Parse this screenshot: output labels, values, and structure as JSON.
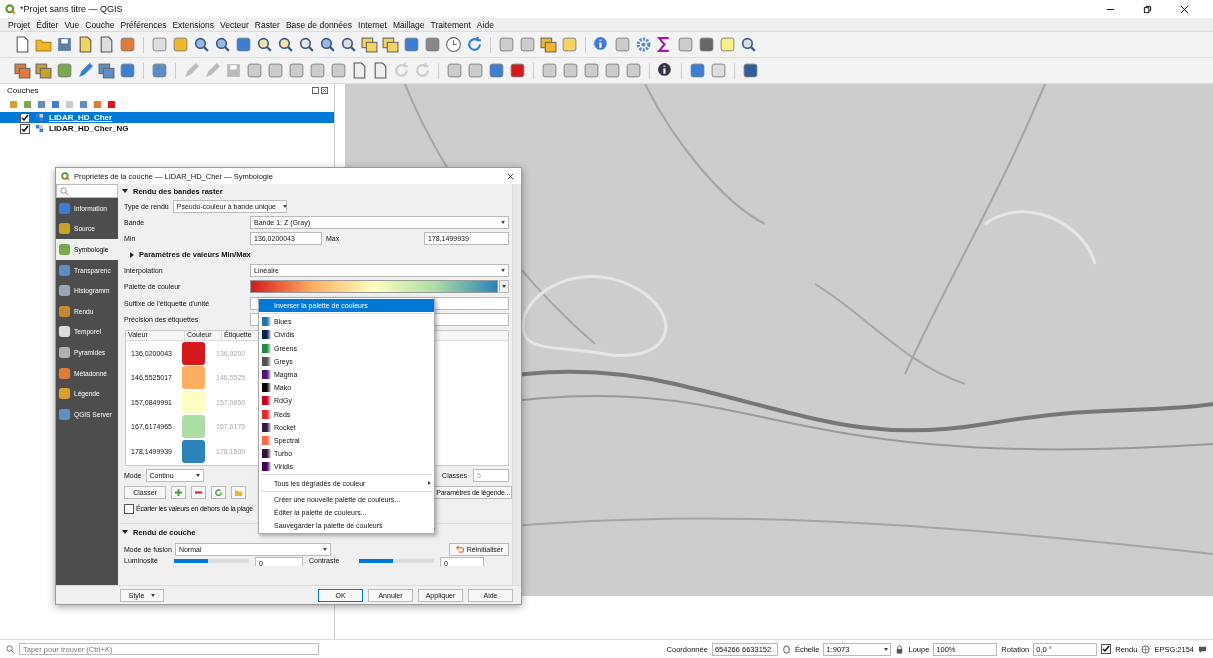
{
  "window": {
    "title": "*Projet sans titre — QGIS"
  },
  "menu": [
    "Projet",
    "Éditer",
    "Vue",
    "Couche",
    "Préférences",
    "Extensions",
    "Vecteur",
    "Raster",
    "Base de données",
    "Internet",
    "Maillage",
    "Traitement",
    "Aide"
  ],
  "layers_panel": {
    "title": "Couches",
    "layers": [
      {
        "name": "LIDAR_HD_Cher",
        "checked": true,
        "selected": true
      },
      {
        "name": "LIDAR_HD_Cher_NG",
        "checked": true,
        "selected": false
      }
    ]
  },
  "dialog": {
    "title": "Propriétés de la couche — LIDAR_HD_Cher — Symbologie",
    "sidebar": [
      {
        "label": "Information",
        "selected": false,
        "color": "#3a7fd5"
      },
      {
        "label": "Source",
        "selected": false,
        "color": "#c9a227"
      },
      {
        "label": "Symbologie",
        "selected": true,
        "color": "#7aa84a"
      },
      {
        "label": "Transparenc",
        "selected": false,
        "color": "#5b8ec9"
      },
      {
        "label": "Histogramm",
        "selected": false,
        "color": "#9aa7b5"
      },
      {
        "label": "Rendu",
        "selected": false,
        "color": "#c58a2e"
      },
      {
        "label": "Temporel",
        "selected": false,
        "color": "#dddddd"
      },
      {
        "label": "Pyramides",
        "selected": false,
        "color": "#b0b0b0"
      },
      {
        "label": "Métadonné",
        "selected": false,
        "color": "#e07b39"
      },
      {
        "label": "Légende",
        "selected": false,
        "color": "#d9a02b"
      },
      {
        "label": "QGIS Server",
        "selected": false,
        "color": "#5e8fc7"
      }
    ],
    "band_section": {
      "title": "Rendu des bandes raster",
      "expanded": true
    },
    "render_type": {
      "label": "Type de rendu",
      "value": "Pseudo-couleur à bande unique"
    },
    "band": {
      "label": "Bande",
      "value": "Bande 1: Z (Gray)"
    },
    "min": {
      "label": "Min",
      "value": "136,0200043"
    },
    "max": {
      "label": "Max",
      "value": "178,1499939"
    },
    "minmax_section": {
      "title": "Paramètres de valeurs Min/Max",
      "expanded": false
    },
    "interpolation": {
      "label": "Interpolation",
      "value": "Linéaire"
    },
    "palette": {
      "label": "Palette de couleur"
    },
    "unit_suffix": {
      "label": "Suffixe de l'étiquette d'unité"
    },
    "precision": {
      "label": "Précision des étiquettes"
    },
    "table": {
      "columns": [
        "Valeur",
        "Couleur",
        "Étiquette"
      ],
      "rows": [
        {
          "value": "136,0200043",
          "color": "#d7191c",
          "label": "136,0200"
        },
        {
          "value": "146,5525017",
          "color": "#fdae61",
          "label": "146,5525"
        },
        {
          "value": "157,0849991",
          "color": "#ffffbf",
          "label": "157,0850"
        },
        {
          "value": "167,6174965",
          "color": "#abdda4",
          "label": "167,6175"
        },
        {
          "value": "178,1499939",
          "color": "#2b83ba",
          "label": "178,1500"
        }
      ]
    },
    "mode": {
      "label": "Mode",
      "value": "Continu"
    },
    "classes": {
      "label": "Classes",
      "value": "5"
    },
    "classify_button": "Classer",
    "legend_button": "Paramètres de légende...",
    "clip_out_of_range": {
      "label": "Écarter les valeurs en dehors de la plage",
      "checked": false
    },
    "layer_section": {
      "title": "Rendu de couche",
      "expanded": true
    },
    "blend_mode": {
      "label": "Mode de fusion",
      "value": "Normal"
    },
    "reset_button": "Réinitialiser",
    "brightness": {
      "label": "Luminosité",
      "level": 0.45,
      "value": "0"
    },
    "contrast": {
      "label": "Contraste",
      "level": 0.45,
      "value": "0"
    },
    "style_button": "Style",
    "buttons": [
      "OK",
      "Annuler",
      "Appliquer",
      "Aide"
    ]
  },
  "ramp_menu": [
    {
      "kind": "action",
      "label": "Inverser la palette de couleurs",
      "selected": true
    },
    {
      "kind": "ramp",
      "label": "Blues",
      "color": "#2171b5",
      "selected": false
    },
    {
      "kind": "ramp",
      "label": "Cividis",
      "color": "#00224e",
      "selected": false
    },
    {
      "kind": "ramp",
      "label": "Greens",
      "color": "#238b45",
      "selected": false
    },
    {
      "kind": "ramp",
      "label": "Greys",
      "color": "#525252",
      "selected": false
    },
    {
      "kind": "ramp",
      "label": "Magma",
      "color": "#51127c",
      "selected": false
    },
    {
      "kind": "ramp",
      "label": "Mako",
      "color": "#0b0405",
      "selected": false
    },
    {
      "kind": "ramp",
      "label": "RdGy",
      "color": "#ca0020",
      "selected": false
    },
    {
      "kind": "ramp",
      "label": "Reds",
      "color": "#de2d26",
      "selected": false
    },
    {
      "kind": "ramp",
      "label": "Rocket",
      "color": "#35193e",
      "selected": false
    },
    {
      "kind": "ramp",
      "label": "Spectral",
      "color": "#f46d43",
      "selected": false
    },
    {
      "kind": "ramp",
      "label": "Turbo",
      "color": "#30123b",
      "selected": false
    },
    {
      "kind": "ramp",
      "label": "Viridis",
      "color": "#440154",
      "selected": false
    },
    {
      "kind": "submenu",
      "label": "Tous les dégradés de couleur",
      "selected": false
    },
    {
      "kind": "action",
      "label": "Créer une nouvelle palette de couleurs...",
      "selected": false
    },
    {
      "kind": "action",
      "label": "Éditer la palette de couleurs...",
      "selected": false
    },
    {
      "kind": "action",
      "label": "Sauvegarder la palette de couleurs",
      "selected": false
    }
  ],
  "status_bar": {
    "search_placeholder": "Taper pour trouver (Ctrl+K)",
    "coordinate": {
      "label": "Coordonnée",
      "value": "654266 6633152"
    },
    "scale": {
      "label": "Échelle",
      "value": "1:9073"
    },
    "magnifier": {
      "label": "Loupe",
      "value": "100%"
    },
    "rotation": {
      "label": "Rotation",
      "value": "0,0 °"
    },
    "render": {
      "label": "Rendu",
      "checked": true
    },
    "crs": "EPSG:2154"
  }
}
